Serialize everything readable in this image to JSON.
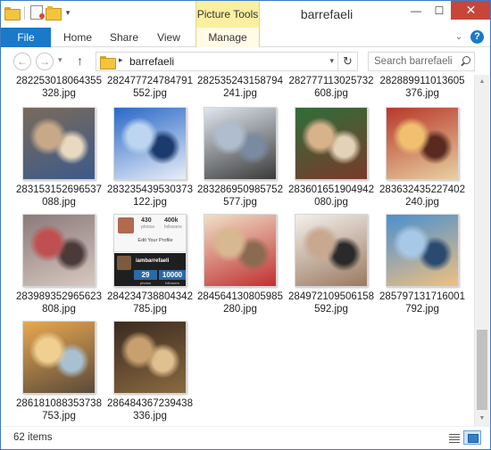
{
  "window": {
    "title": "barrefaeli",
    "contextual_tab_group": "Picture Tools",
    "minimize_glyph": "—",
    "maximize_glyph": "☐",
    "close_glyph": "✕"
  },
  "quick_access_toolbar": {
    "icons": [
      "folder-icon",
      "properties-icon",
      "new-folder-icon"
    ],
    "dropdown_glyph": "▾"
  },
  "ribbon": {
    "file_tab": "File",
    "tabs": [
      "Home",
      "Share",
      "View",
      "Manage"
    ],
    "expand_glyph": "⌄",
    "help_glyph": "?"
  },
  "navigation": {
    "back_glyph": "←",
    "forward_glyph": "→",
    "recent_glyph": "▾",
    "up_glyph": "↑",
    "breadcrumb_separator": "▸",
    "path": "barrefaeli",
    "address_dropdown_glyph": "▾",
    "refresh_glyph": "↻",
    "search_placeholder": "Search barrefaeli"
  },
  "top_row_partial_names": [
    [
      "282253018064355",
      "328.jpg"
    ],
    [
      "282477724784791",
      "552.jpg"
    ],
    [
      "282535243158794",
      "241.jpg"
    ],
    [
      "282777113025732",
      "608.jpg"
    ],
    [
      "282889911013605",
      "376.jpg"
    ]
  ],
  "files": [
    {
      "name": [
        "283153152696537",
        "088.jpg"
      ],
      "palette": [
        "#7a6a5a",
        "#c7a98a",
        "#3c5a8a",
        "#e8d9c0"
      ]
    },
    {
      "name": [
        "283235439530373",
        "122.jpg"
      ],
      "palette": [
        "#2a68c8",
        "#bcd6f0",
        "#e8eef6",
        "#1b3b6e"
      ]
    },
    {
      "name": [
        "283286950985752",
        "577.jpg"
      ],
      "palette": [
        "#dfe6ee",
        "#b0bdcc",
        "#3a3a3a",
        "#7a8aa0"
      ]
    },
    {
      "name": [
        "283601651904942",
        "080.jpg"
      ],
      "palette": [
        "#2f6e3a",
        "#d7b28a",
        "#7a3a2a",
        "#e3d2b8"
      ]
    },
    {
      "name": [
        "283632435227402",
        "240.jpg"
      ],
      "palette": [
        "#b8382a",
        "#f0c070",
        "#e8d0a0",
        "#5a2a20"
      ]
    },
    {
      "name": [
        "283989352965623",
        "808.jpg"
      ],
      "palette": [
        "#8a7a7a",
        "#c05050",
        "#d8c8c0",
        "#4a3a3a"
      ]
    },
    {
      "name": [
        "284234738804342",
        "785.jpg"
      ],
      "palette": [
        "#ffffff",
        "#e0e0e0",
        "#2a2a2a",
        "#1e5a96"
      ],
      "profile": {
        "posts": "430",
        "posts_label": "photos",
        "followers": "400k",
        "followers_label": "followers",
        "edit_label": "Edit Your Profile",
        "username": "iambarrefaeli",
        "count_a": "29",
        "count_a_label": "photos",
        "count_b": "10000",
        "count_b_label": "followers"
      }
    },
    {
      "name": [
        "284564130805985",
        "280.jpg"
      ],
      "palette": [
        "#f0e0c8",
        "#d8b890",
        "#c03030",
        "#8a6a50"
      ]
    },
    {
      "name": [
        "284972109506158",
        "592.jpg"
      ],
      "palette": [
        "#f4f0ec",
        "#c8a890",
        "#9a7a60",
        "#2a2a2a"
      ]
    },
    {
      "name": [
        "285797131716001",
        "792.jpg"
      ],
      "palette": [
        "#4a90d0",
        "#a8c8e8",
        "#f0c080",
        "#2a4a70"
      ]
    },
    {
      "name": [
        "286181088353738",
        "753.jpg"
      ],
      "palette": [
        "#e8a850",
        "#f0d090",
        "#5a4a3a",
        "#a8c0d0"
      ]
    },
    {
      "name": [
        "286484367239438",
        "336.jpg"
      ],
      "palette": [
        "#3a2a20",
        "#c8a070",
        "#8a6a40",
        "#e0c090"
      ]
    }
  ],
  "status": {
    "item_count": "62 items"
  },
  "scrollbar": {
    "up_glyph": "▲",
    "down_glyph": "▼"
  }
}
